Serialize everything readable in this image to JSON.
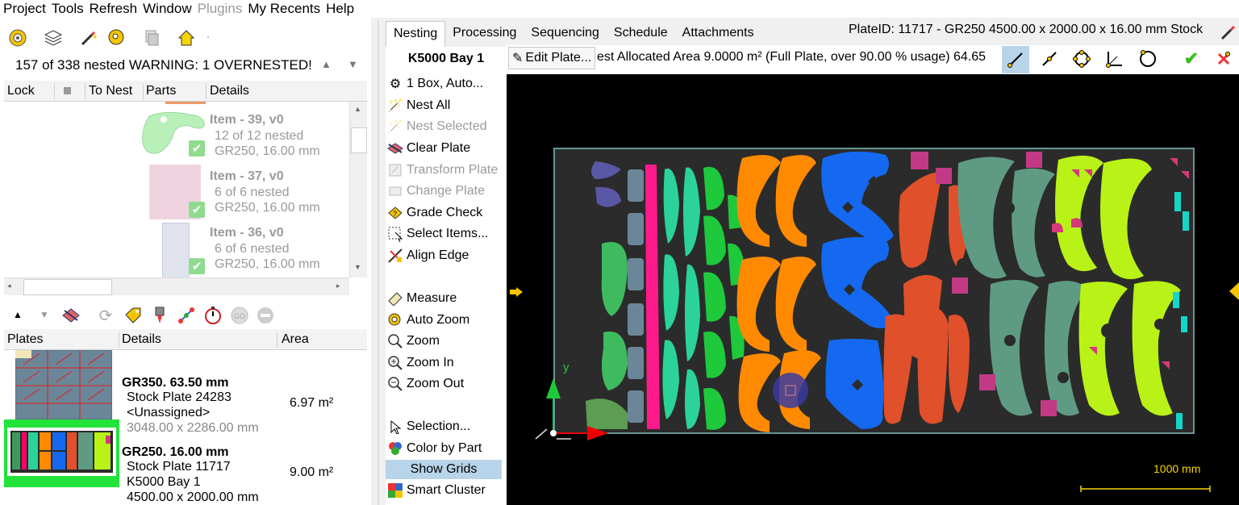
{
  "menu": [
    "Project",
    "Tools",
    "Refresh",
    "Window",
    "Plugins",
    "My Recents",
    "Help"
  ],
  "nest_status": "157 of 338 nested  WARNING: 1 OVERNESTED!",
  "parts_columns": [
    "Lock",
    "To Nest",
    "Parts",
    "Details"
  ],
  "parts": [
    {
      "title": "Item - 39, v0",
      "line1": "12 of 12 nested",
      "line2": "GR250, 16.00 mm",
      "color": "#b9f0b9"
    },
    {
      "title": "Item - 37, v0",
      "line1": "6 of 6 nested",
      "line2": "GR250, 16.00 mm",
      "color": "#efd4e0"
    },
    {
      "title": "Item - 36, v0",
      "line1": "6 of 6 nested",
      "line2": "GR250, 16.00 mm",
      "color": "#dfe3ee"
    }
  ],
  "plates_columns": [
    "Plates",
    "Details",
    "Area"
  ],
  "plates": [
    {
      "line1": "GR350. 63.50 mm",
      "line2": "Stock Plate 24283",
      "line3": "<Unassigned>",
      "line4": "3048.00 x 2286.00 mm",
      "area": "6.97 m²"
    },
    {
      "line1": "GR250. 16.00 mm",
      "line2": "Stock Plate 11717",
      "line3": "K5000 Bay 1",
      "line4": "4500.00 x 2000.00 mm",
      "area": "9.00 m²"
    }
  ],
  "tabs": [
    "Nesting",
    "Processing",
    "Sequencing",
    "Schedule",
    "Attachments"
  ],
  "plate_header": "PlateID: 11717 - GR250 4500.00 x 2000.00 x 16.00 mm Stock",
  "machine": "K5000 Bay 1",
  "edit_plate": "Edit Plate...",
  "info_text": "est Allocated Area 9.0000 m² (Full Plate, over 90.00 % usage) 64.65",
  "commands": [
    {
      "label": "1 Box, Auto...",
      "icon": "gear-icon",
      "disabled": false
    },
    {
      "label": "Nest All",
      "icon": "wand-icon",
      "disabled": false
    },
    {
      "label": "Nest Selected",
      "icon": "wand-icon",
      "disabled": true
    },
    {
      "label": "Clear Plate",
      "icon": "clear-icon",
      "disabled": false
    },
    {
      "label": "Transform Plate",
      "icon": "transform-icon",
      "disabled": true
    },
    {
      "label": "Change Plate",
      "icon": "plate-icon",
      "disabled": true
    },
    {
      "label": "Grade Check",
      "icon": "grade-icon",
      "disabled": false
    },
    {
      "label": "Select Items...",
      "icon": "select-icon",
      "disabled": false
    },
    {
      "label": "Align Edge",
      "icon": "align-icon",
      "disabled": false
    },
    {
      "label": "Measure",
      "icon": "ruler-icon",
      "disabled": false
    },
    {
      "label": "Auto Zoom",
      "icon": "zoom-icon",
      "disabled": false
    },
    {
      "label": "Zoom",
      "icon": "zoom-icon",
      "disabled": false
    },
    {
      "label": "Zoom In",
      "icon": "zoom-in-icon",
      "disabled": false
    },
    {
      "label": "Zoom Out",
      "icon": "zoom-out-icon",
      "disabled": false
    },
    {
      "label": "Selection...",
      "icon": "cursor-icon",
      "disabled": false
    },
    {
      "label": "Color by Part",
      "icon": "color-icon",
      "disabled": false
    },
    {
      "label": "Show Grids",
      "icon": "grid-icon",
      "disabled": false
    },
    {
      "label": "Smart Cluster",
      "icon": "cluster-icon",
      "disabled": false
    }
  ],
  "scale_label": "1000 mm",
  "axis_y": "y",
  "colors": {
    "plate_border": "#7fbfbf",
    "canvas": "#000000",
    "selected": "#b8d4ea",
    "green_bar": "#21e33a"
  }
}
